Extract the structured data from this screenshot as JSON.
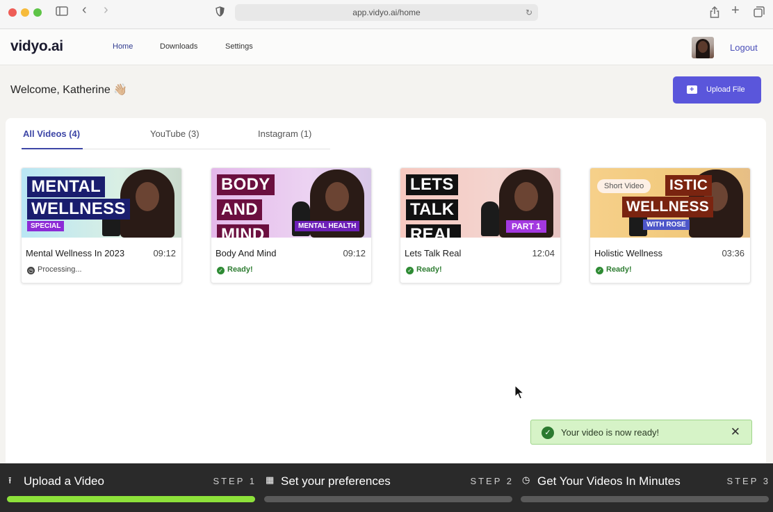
{
  "browser": {
    "url": "app.vidyo.ai/home"
  },
  "nav": {
    "logo": "vidyo.ai",
    "links": [
      "Home",
      "Downloads",
      "Settings"
    ],
    "logout": "Logout"
  },
  "welcome": "Welcome, Katherine 👋🏼",
  "upload_button": "Upload File",
  "tabs": [
    "All Videos (4)",
    "YouTube (3)",
    "Instagram (1)"
  ],
  "videos": [
    {
      "title": "Mental Wellness In 2023",
      "duration": "09:12",
      "status": "Processing...",
      "thumb_lines": [
        "MENTAL",
        "WELLNESS"
      ],
      "thumb_tag": "SPECIAL"
    },
    {
      "title": "Body And Mind",
      "duration": "09:12",
      "status": "Ready!",
      "thumb_lines": [
        "BODY",
        "AND",
        "MIND"
      ],
      "thumb_tag": "MENTAL HEALTH"
    },
    {
      "title": "Lets Talk Real",
      "duration": "12:04",
      "status": "Ready!",
      "thumb_lines": [
        "LETS",
        "TALK",
        "REAL"
      ],
      "thumb_tag": "PART 1"
    },
    {
      "title": "Holistic Wellness",
      "duration": "03:36",
      "status": "Ready!",
      "thumb_lines": [
        "ISTIC",
        "WELLNESS"
      ],
      "thumb_tag": "WITH ROSE",
      "badge": "Short Video"
    }
  ],
  "toast": {
    "message": "Your video is now ready!"
  },
  "steps": [
    {
      "label": "Upload a Video",
      "num": "STEP 1",
      "progress": 1.0
    },
    {
      "label": "Set your preferences",
      "num": "STEP 2",
      "progress": 0.0
    },
    {
      "label": "Get Your Videos In Minutes",
      "num": "STEP 3",
      "progress": 0.0
    }
  ],
  "colors": {
    "accent": "#5a56db",
    "ready": "#2e8b34",
    "step_active": "#8de13a"
  }
}
